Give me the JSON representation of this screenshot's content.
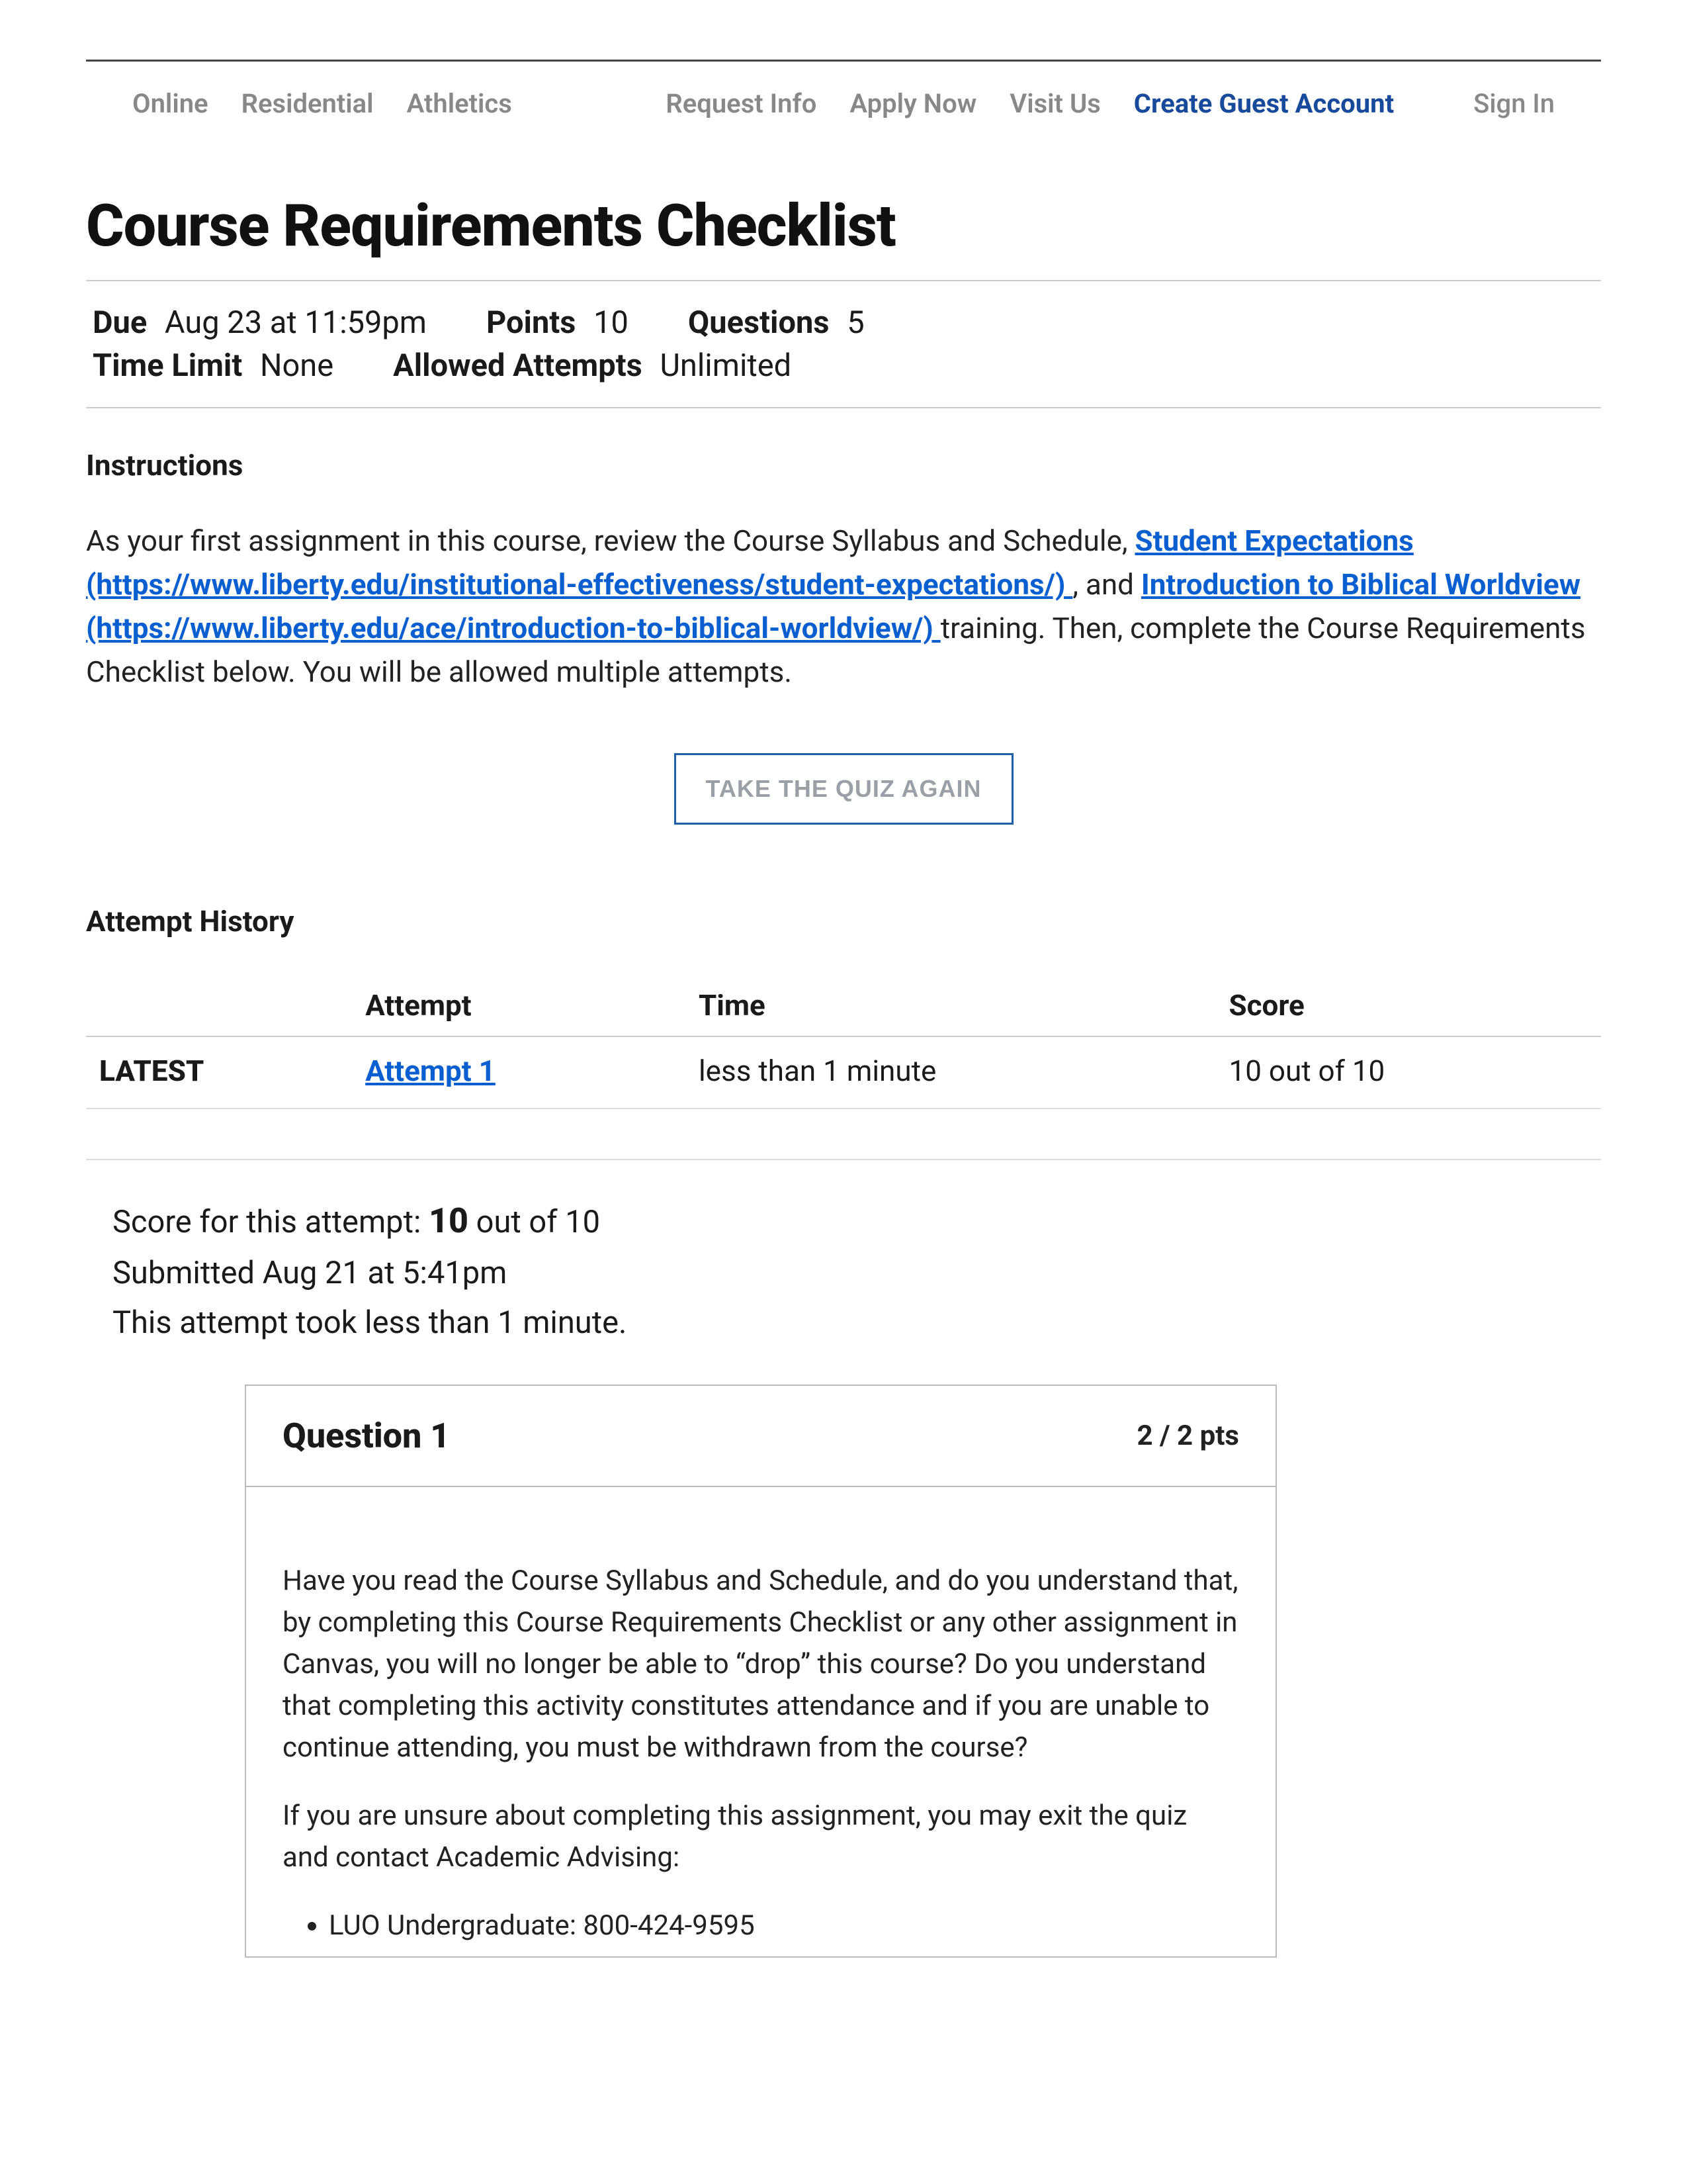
{
  "nav": {
    "left": [
      "Online",
      "Residential",
      "Athletics"
    ],
    "right": [
      "Request Info",
      "Apply Now",
      "Visit Us"
    ],
    "primary": "Create Guest Account",
    "signin": "Sign In"
  },
  "page": {
    "title": "Course Requirements Checklist"
  },
  "meta": {
    "due_label": "Due",
    "due_value": "Aug 23 at 11:59pm",
    "points_label": "Points",
    "points_value": "10",
    "questions_label": "Questions",
    "questions_value": "5",
    "timelimit_label": "Time Limit",
    "timelimit_value": "None",
    "attempts_label": "Allowed Attempts",
    "attempts_value": "Unlimited"
  },
  "instructions": {
    "heading": "Instructions",
    "text_pre": "As your first assignment in this course, review the Course Syllabus and Schedule, ",
    "link1_text": "Student Expectations",
    "link1_url_display": "(https://www.liberty.edu/institutional-effectiveness/student-expectations/)",
    "text_mid": " , and ",
    "link2_text": "Introduction to Biblical Worldview",
    "link2_url_display": " (https://www.liberty.edu/ace/introduction-to-biblical-worldview/) ",
    "text_post": "training. Then, complete the Course Requirements Checklist below. You will be allowed multiple attempts."
  },
  "take_quiz_label": "TAKE THE QUIZ AGAIN",
  "history": {
    "heading": "Attempt History",
    "columns": [
      "",
      "Attempt",
      "Time",
      "Score"
    ],
    "rows": [
      {
        "tag": "LATEST",
        "attempt": "Attempt 1",
        "time": "less than 1 minute",
        "score": "10 out of 10"
      }
    ]
  },
  "score_block": {
    "line1_pre": "Score for this attempt: ",
    "line1_big": "10",
    "line1_post": " out of 10",
    "line2": "Submitted Aug 21 at 5:41pm",
    "line3": "This attempt took less than 1 minute."
  },
  "question1": {
    "title": "Question 1",
    "pts": "2 / 2 pts",
    "para1": "Have you read the Course Syllabus and Schedule, and do you understand that, by completing this Course Requirements Checklist or any other assignment in Canvas, you will no longer be able to “drop” this course? Do you understand that completing this activity constitutes attendance and if you are unable to continue attending, you must be withdrawn from the course?",
    "para2": "If you are unsure about completing this assignment, you may exit the quiz and contact Academic Advising:",
    "bullets": [
      "LUO Undergraduate: 800-424-9595"
    ]
  }
}
